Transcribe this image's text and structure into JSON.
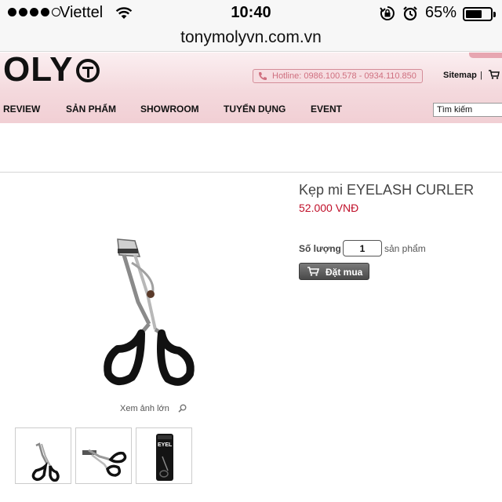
{
  "status_bar": {
    "carrier": "Viettel",
    "time": "10:40",
    "battery_percent": "65%",
    "battery_level": 0.65,
    "icons": [
      "signal-dots",
      "wifi-icon",
      "rotation-lock-icon",
      "alarm-icon",
      "battery-icon"
    ]
  },
  "browser": {
    "url": "tonymolyvn.com.vn"
  },
  "site": {
    "logo_text": "OLY",
    "hotline": "Hotline: 0986.100.578 - 0934.110.850",
    "sitemap": "Sitemap",
    "sitemap_separator": "|",
    "nav": [
      "REVIEW",
      "SẢN PHẨM",
      "SHOWROOM",
      "TUYỂN DỤNG",
      "EVENT"
    ],
    "search_placeholder": "Tìm kiếm",
    "colors": {
      "header_pink": "#f4d9dd",
      "price_red": "#c0102a",
      "hotline_pink": "#cf6f7f"
    }
  },
  "product": {
    "title": "Kẹp mi EYELASH CURLER",
    "price": "52.000 VNĐ",
    "quantity_label": "Số lượng",
    "quantity_value": "1",
    "quantity_unit": "sản phẩm",
    "buy_label": "Đặt mua",
    "zoom_label": "Xem ảnh lớn",
    "thumb_text": "EYEL"
  }
}
